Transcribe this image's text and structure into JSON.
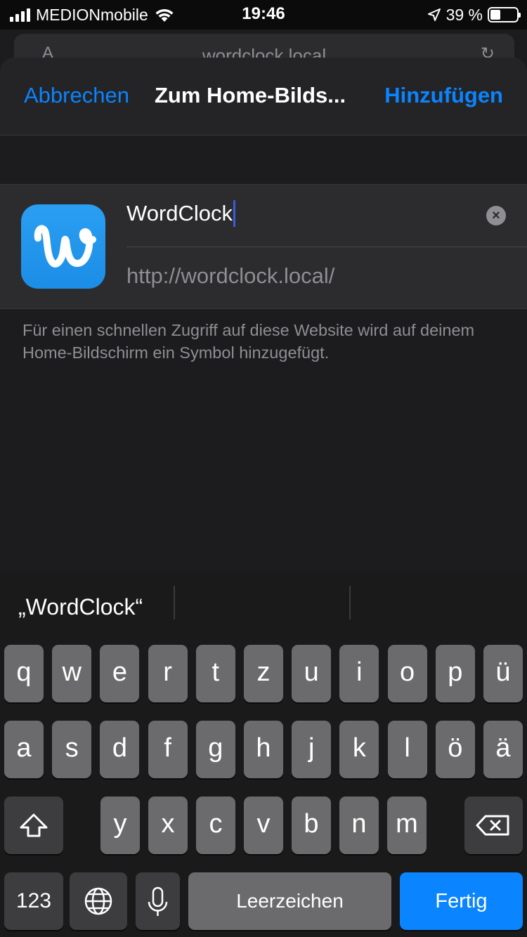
{
  "status_bar": {
    "carrier": "MEDIONmobile",
    "time": "19:46",
    "battery_text": "39 %",
    "battery_level": 0.39,
    "icons": [
      "signal-bars-icon",
      "wifi-icon",
      "location-arrow-icon",
      "battery-icon"
    ]
  },
  "background_page": {
    "url": "wordclock.local"
  },
  "nav": {
    "cancel": "Abbrechen",
    "title": "Zum Home-Bilds...",
    "add": "Hinzufügen"
  },
  "bookmark": {
    "icon_letter": "w",
    "name_value": "WordClock",
    "url": "http://wordclock.local/"
  },
  "footnote": "Für einen schnellen Zugriff auf diese Website wird auf deinem Home-Bildschirm ein Symbol hinzugefügt.",
  "keyboard": {
    "suggestion": "„WordClock“",
    "row1": [
      "q",
      "w",
      "e",
      "r",
      "t",
      "z",
      "u",
      "i",
      "o",
      "p",
      "ü"
    ],
    "row2": [
      "a",
      "s",
      "d",
      "f",
      "g",
      "h",
      "j",
      "k",
      "l",
      "ö",
      "ä"
    ],
    "row3": [
      "y",
      "x",
      "c",
      "v",
      "b",
      "n",
      "m"
    ],
    "numbers": "123",
    "space": "Leerzeichen",
    "done": "Fertig"
  },
  "colors": {
    "accent": "#0a84ff",
    "icon_blue": "#1c8de6",
    "background": "#1c1c1e"
  }
}
